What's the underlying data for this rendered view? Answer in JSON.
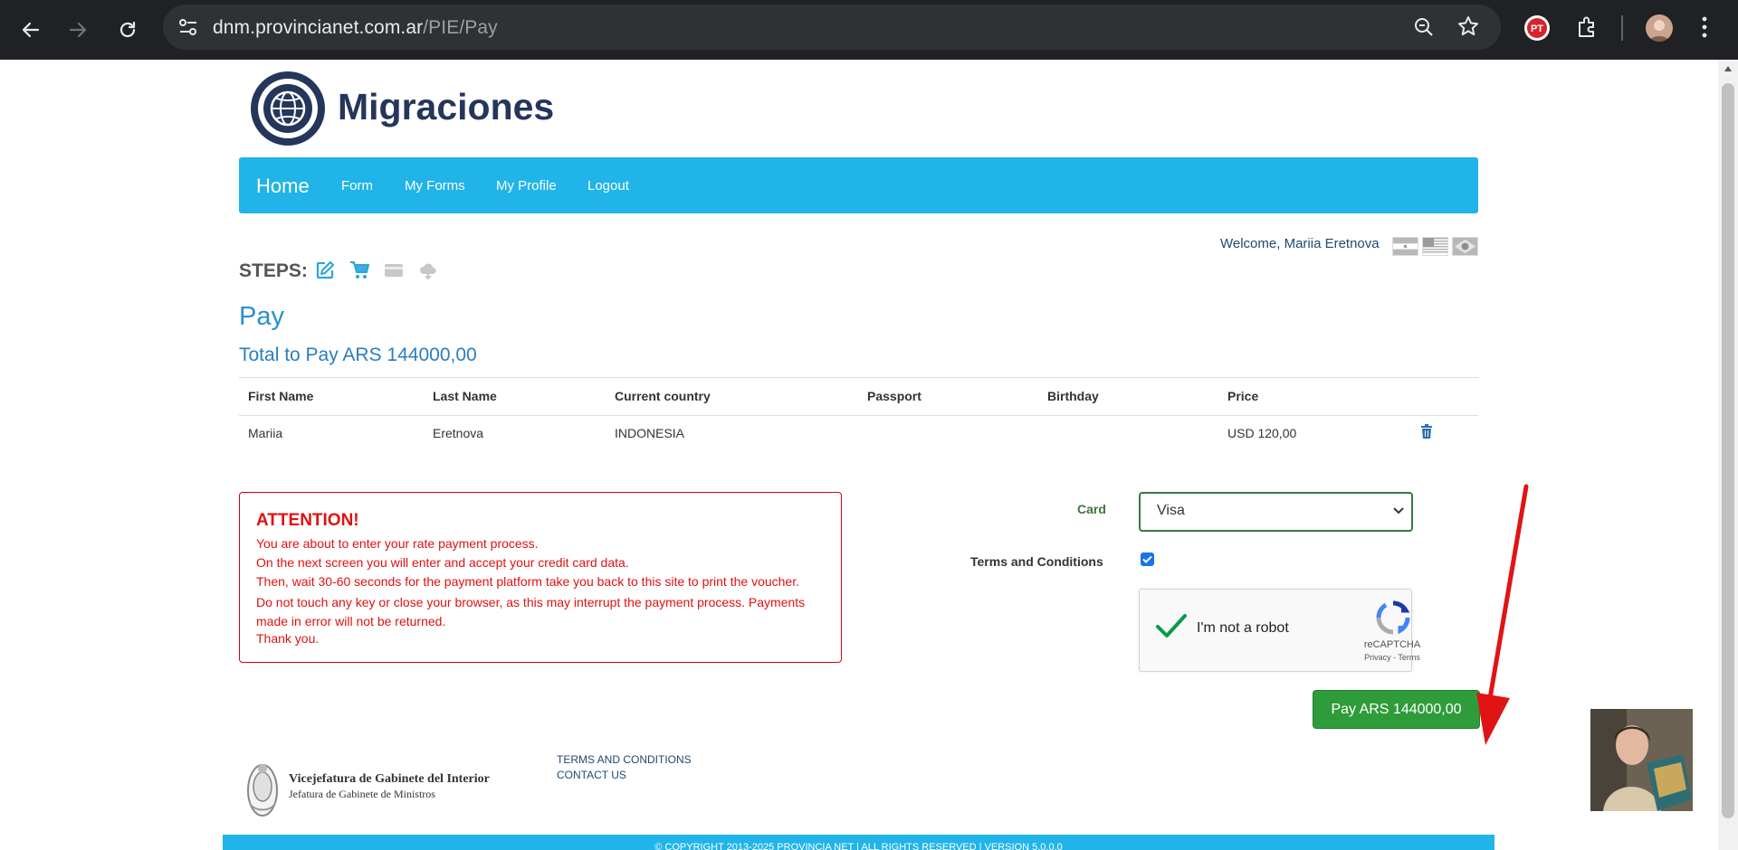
{
  "browser": {
    "url_host": "dnm.provincianet.com.ar",
    "url_path": "/PIE/Pay"
  },
  "brand": {
    "name": "Migraciones"
  },
  "nav": {
    "home": "Home",
    "items": [
      "Form",
      "My Forms",
      "My Profile",
      "Logout"
    ]
  },
  "welcome": "Welcome, Mariia Eretnova",
  "steps_label": "STEPS:",
  "page_title": "Pay",
  "total": "Total to Pay ARS 144000,00",
  "table": {
    "headers": [
      "First Name",
      "Last Name",
      "Current country",
      "Passport",
      "Birthday",
      "Price"
    ],
    "rows": [
      {
        "first_name": "Mariia",
        "last_name": "Eretnova",
        "country": "INDONESIA",
        "passport": "",
        "birthday": "",
        "price": "USD 120,00"
      }
    ]
  },
  "attention": {
    "title": "ATTENTION!",
    "lines": [
      "You are about to enter your rate payment process.",
      "On the next screen you will enter and accept your credit card data.",
      "Then, wait 30-60 seconds for the payment platform take you back to this site to print the voucher.",
      "Do not touch any key or close your browser, as this may interrupt the payment process. Payments made in error will not be returned.",
      "Thank you."
    ]
  },
  "form": {
    "card_label": "Card",
    "card_value": "Visa",
    "terms_label": "Terms and Conditions",
    "terms_checked": true
  },
  "captcha": {
    "label": "I'm not a robot",
    "brand": "reCAPTCHA",
    "links": "Privacy - Terms"
  },
  "pay_button": "Pay ARS 144000,00",
  "footer": {
    "logo_title": "Vicejefatura de Gabinete del Interior",
    "logo_subtitle": "Jefatura de Gabinete de Ministros",
    "links": [
      "TERMS AND CONDITIONS",
      "CONTACT US"
    ],
    "copyright": "© COPYRIGHT 2013-2025 PROVINCIA NET | ALL RIGHTS RESERVED | VERSION 5.0.0.0"
  },
  "colors": {
    "nav": "#20b4e8",
    "heading": "#2a8fd0",
    "attention": "#e01010",
    "pay_button": "#2e9c3a",
    "brand": "#25365b"
  }
}
